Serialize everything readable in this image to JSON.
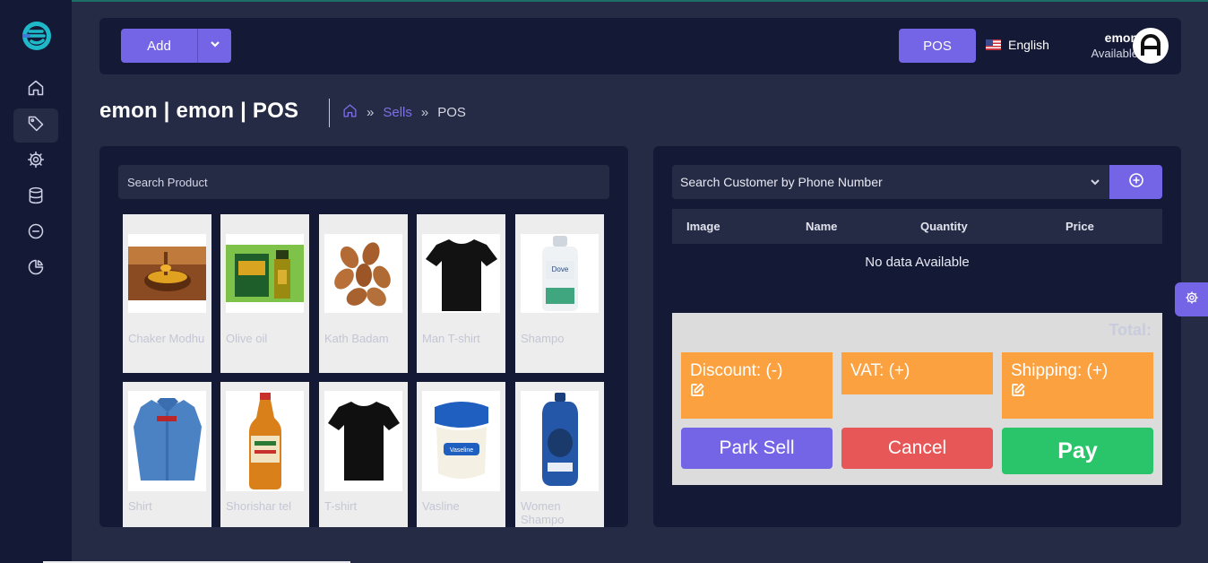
{
  "header": {
    "add_label": "Add",
    "pos_label": "POS",
    "language": "English",
    "user_name": "emon",
    "user_status": "Available"
  },
  "page": {
    "title": "emon | emon | POS",
    "breadcrumb": {
      "link": "Sells",
      "current": "POS",
      "separator": "»"
    }
  },
  "sidebar": {
    "items": [
      {
        "name": "home-icon",
        "active": false
      },
      {
        "name": "tag-icon",
        "active": true
      },
      {
        "name": "gear-icon",
        "active": false
      },
      {
        "name": "database-icon",
        "active": false
      },
      {
        "name": "minus-circle-icon",
        "active": false
      },
      {
        "name": "pie-chart-icon",
        "active": false
      }
    ]
  },
  "products": {
    "search_placeholder": "Search Product",
    "items": [
      {
        "name": "Chaker Modhu",
        "icon": "honey-bowl"
      },
      {
        "name": "Olive oil",
        "icon": "olive-oil-tin"
      },
      {
        "name": "Kath Badam",
        "icon": "almonds"
      },
      {
        "name": "Man T-shirt",
        "icon": "black-tshirt"
      },
      {
        "name": "Shampo",
        "icon": "shampoo-bottle"
      },
      {
        "name": "Shirt",
        "icon": "blue-shirt"
      },
      {
        "name": "Shorishar tel",
        "icon": "mustard-oil-bottle"
      },
      {
        "name": "T-shirt",
        "icon": "black-tshirt"
      },
      {
        "name": "Vasline",
        "icon": "vaseline-jar"
      },
      {
        "name": "Women Shampo",
        "icon": "blue-shampoo-bottle"
      }
    ]
  },
  "cart": {
    "customer_placeholder": "Search Customer by Phone Number",
    "columns": [
      "Image",
      "Name",
      "Quantity",
      "Price"
    ],
    "empty_text": "No data Available",
    "total_label": "Total:",
    "discount_label": "Discount: (-)",
    "vat_label": "VAT: (+)",
    "shipping_label": "Shipping: (+)",
    "park_label": "Park Sell",
    "cancel_label": "Cancel",
    "pay_label": "Pay"
  },
  "colors": {
    "accent": "#7464e6",
    "sidebar": "#141935",
    "background": "#262b45",
    "charge": "#fba13f",
    "cancel": "#e85757",
    "pay": "#2ac56a"
  }
}
